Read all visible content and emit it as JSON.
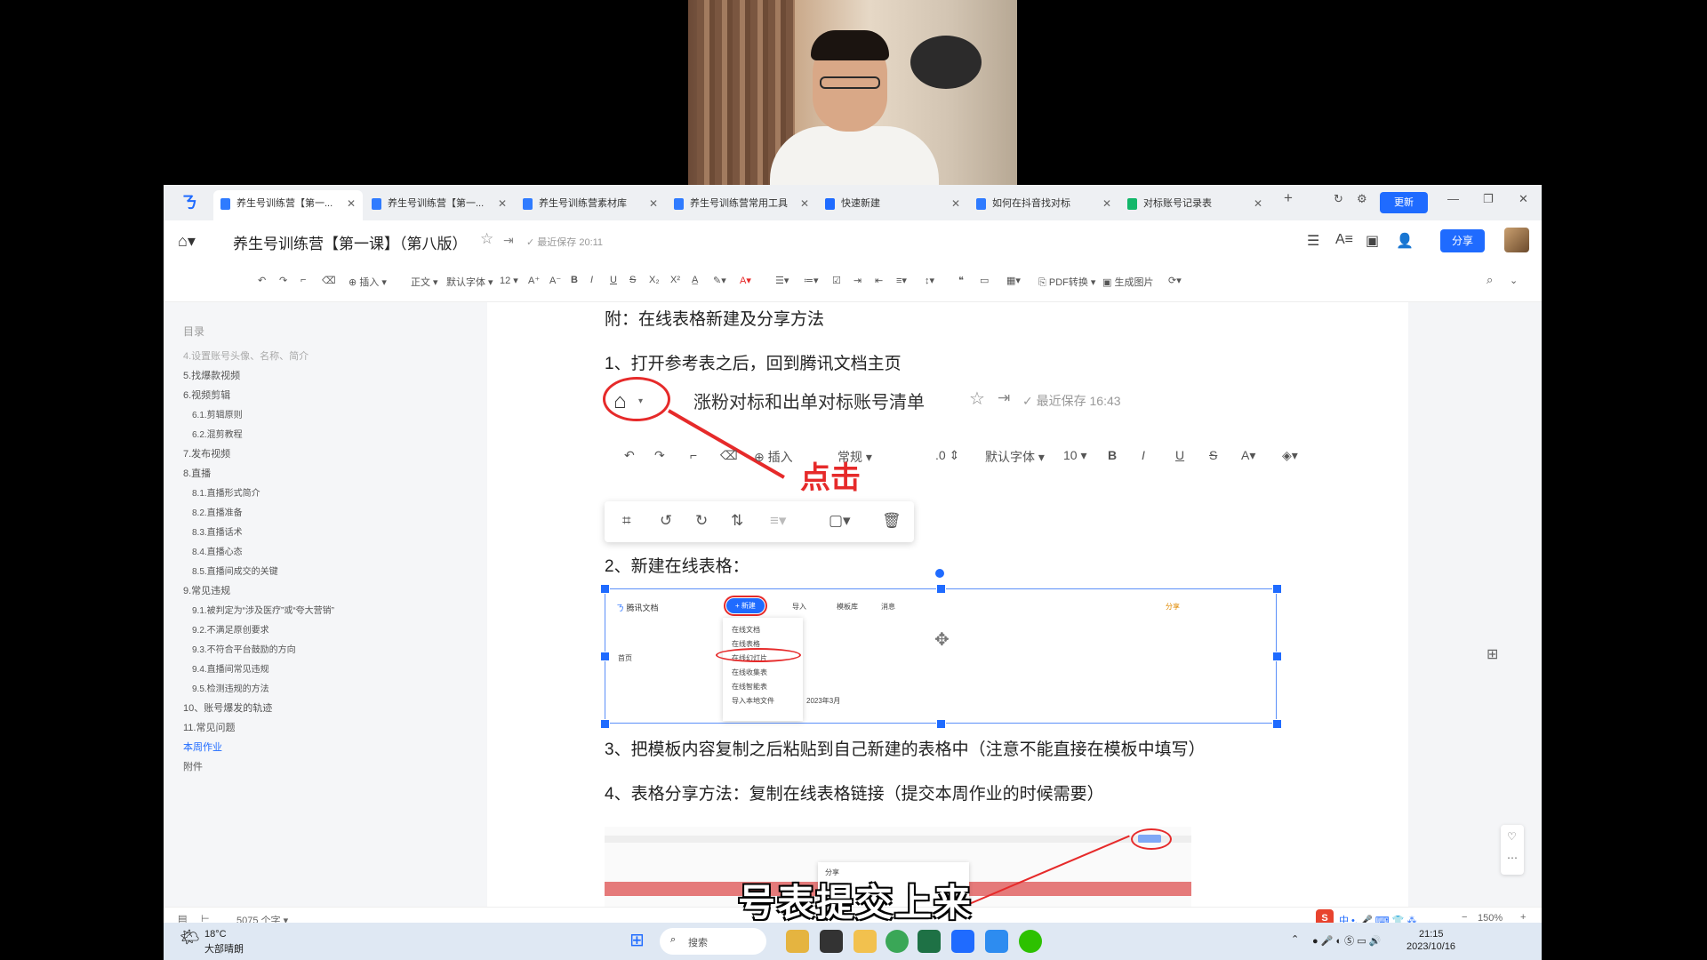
{
  "tabs": [
    {
      "label": "养生号训练营【第一...",
      "active": true
    },
    {
      "label": "养生号训练营【第一..."
    },
    {
      "label": "养生号训练营素材库"
    },
    {
      "label": "养生号训练营常用工具"
    },
    {
      "label": "快速新建"
    },
    {
      "label": "如何在抖音找对标"
    },
    {
      "label": "对标账号记录表"
    }
  ],
  "window": {
    "update_label": "更新",
    "new_tab": "+"
  },
  "titlebar": {
    "title": "养生号训练营【第一课】（第八版）",
    "save_status": "最近保存 20:11",
    "share_label": "分享"
  },
  "toolbar": {
    "insert": "插入",
    "style": "正文",
    "font": "默认字体",
    "size": "12",
    "pdf": "PDF转换",
    "gen_image": "生成图片"
  },
  "toc": {
    "heading": "目录",
    "items": [
      "4.设置账号头像、名称、简介",
      "5.找爆款视频",
      "6.视频剪辑",
      "6.1.剪辑原则",
      "6.2.混剪教程",
      "7.发布视频",
      "8.直播",
      "8.1.直播形式简介",
      "8.2.直播准备",
      "8.3.直播话术",
      "8.4.直播心态",
      "8.5.直播间成交的关键",
      "9.常见违规",
      "9.1.被判定为“涉及医疗”或“夸大营销”",
      "9.2.不满足原创要求",
      "9.3.不符合平台鼓励的方向",
      "9.4.直播间常见违规",
      "9.5.检测违规的方法",
      "10、账号爆发的轨迹",
      "11.常见问题",
      "本周作业",
      "附件"
    ]
  },
  "content": {
    "heading": "附：在线表格新建及分享方法",
    "step1": "1、打开参考表之后，回到腾讯文档主页",
    "img1_title": "涨粉对标和出单对标账号清单",
    "img1_save": "最近保存 16:43",
    "img1_click": "点击",
    "img1_insert": "插入",
    "img1_style": "常规",
    "img1_num": ".0",
    "img1_font": "默认字体",
    "img1_size": "10",
    "step2": "2、新建在线表格：",
    "step3": "3、把模板内容复制之后粘贴到自己新建的表格中（注意不能直接在模板中填写）",
    "step4": "4、表格分享方法：复制在线表格链接（提交本周作业的时候需要）",
    "img2": {
      "brand": "腾讯文档",
      "new": "+ 新建",
      "import": "导入",
      "template": "模板库",
      "inbox": "消息",
      "share": "分享",
      "menu": [
        "在线文档",
        "在线表格",
        "在线幻灯片",
        "在线收集表",
        "在线智能表",
        "导入本地文件"
      ],
      "date": "2023年3月",
      "nav_home": "首页"
    },
    "img3": {
      "share": "分享"
    }
  },
  "statusbar": {
    "word_count": "5075 个字",
    "zoom": "150%"
  },
  "taskbar": {
    "temp": "18°C",
    "weather": "大部晴朗",
    "search": "搜索",
    "time": "21:15",
    "date": "2023/10/16",
    "ime": "中"
  },
  "subtitle": "号表提交上来",
  "colors": {
    "accent": "#1f6bff",
    "annotation_red": "#e62a2a"
  }
}
